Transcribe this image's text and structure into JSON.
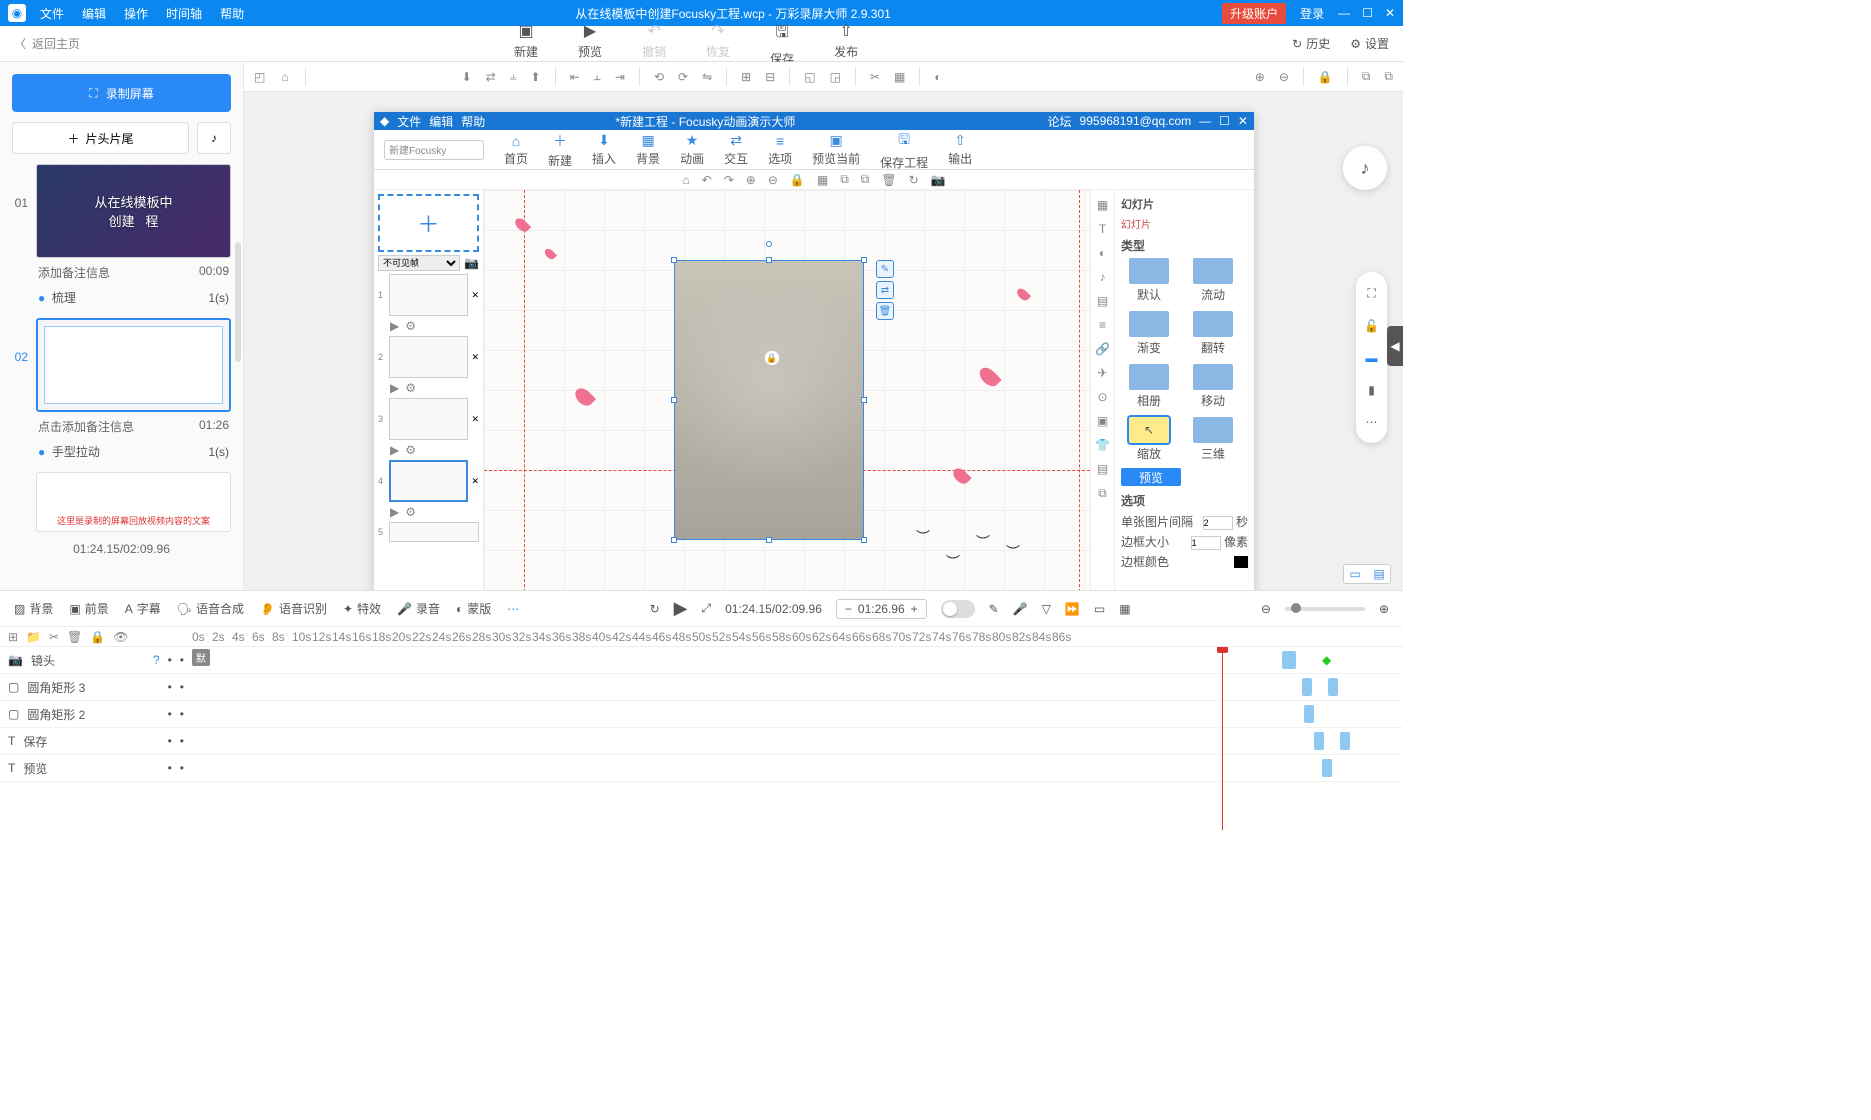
{
  "titlebar": {
    "menu": [
      "文件",
      "编辑",
      "操作",
      "时间轴",
      "帮助"
    ],
    "title": "从在线模板中创建Focusky工程.wcp - 万彩录屏大师 2.9.301",
    "upgrade": "升级账户",
    "login": "登录"
  },
  "subbar": {
    "back": "返回主页",
    "tools": [
      {
        "label": "新建",
        "icon": "＋"
      },
      {
        "label": "预览",
        "icon": "▶"
      },
      {
        "label": "撤销",
        "icon": "↶",
        "disabled": true
      },
      {
        "label": "恢复",
        "icon": "↷",
        "disabled": true
      },
      {
        "label": "保存",
        "icon": "🖫"
      },
      {
        "label": "发布",
        "icon": "⇧"
      }
    ],
    "history": "历史",
    "settings": "设置"
  },
  "leftpane": {
    "record": "录制屏幕",
    "headtail": "片头片尾",
    "slides": [
      {
        "num": "01",
        "note": "添加备注信息",
        "time": "00:09",
        "action": "梳理",
        "dur": "1(s)"
      },
      {
        "num": "02",
        "note": "点击添加备注信息",
        "time": "01:26",
        "action": "手型拉动",
        "dur": "1(s)",
        "selected": true
      }
    ],
    "timeTotal": "01:24.15/02:09.96"
  },
  "inner": {
    "title": "*新建工程 - Focusky动画演示大师",
    "menu": [
      "文件",
      "编辑",
      "帮助"
    ],
    "forum": "论坛",
    "user": "995968191@qq.com",
    "search": "新建Focusky",
    "tools": [
      "首页",
      "新建",
      "插入",
      "背景",
      "动画",
      "交互",
      "选项",
      "预览当前",
      "保存工程",
      "输出"
    ],
    "visibility": "不可见帧",
    "rightPanel": {
      "title": "幻灯片",
      "sub": "幻灯片",
      "section": "类型",
      "options": [
        "默认",
        "流动",
        "渐变",
        "翻转",
        "相册",
        "移动",
        "缩放",
        "三维"
      ],
      "preview": "预览",
      "opts_label": "选项",
      "fields": [
        {
          "label": "单张图片间隔",
          "value": "2",
          "unit": "秒"
        },
        {
          "label": "边框大小",
          "value": "1",
          "unit": "像素"
        },
        {
          "label": "边框颜色",
          "value": "#000"
        }
      ]
    }
  },
  "timeline": {
    "tabs": [
      "背景",
      "前景",
      "字幕",
      "语音合成",
      "语音识别",
      "特效",
      "录音",
      "蒙版"
    ],
    "time": "01:24.15/02:09.96",
    "box_time": "01:26.96",
    "tracks": [
      {
        "icon": "📷",
        "name": "镜头",
        "help": true,
        "default": "默"
      },
      {
        "icon": "▢",
        "name": "圆角矩形 3"
      },
      {
        "icon": "▢",
        "name": "圆角矩形 2"
      },
      {
        "icon": "T",
        "name": "保存"
      },
      {
        "icon": "T",
        "name": "预览"
      }
    ],
    "ticks": [
      "0s",
      "2s",
      "4s",
      "6s",
      "8s",
      "10s",
      "12s",
      "14s",
      "16s",
      "18s",
      "20s",
      "22s",
      "24s",
      "26s",
      "28s",
      "30s",
      "32s",
      "34s",
      "36s",
      "38s",
      "40s",
      "42s",
      "44s",
      "46s",
      "48s",
      "50s",
      "52s",
      "54s",
      "56s",
      "58s",
      "60s",
      "62s",
      "64s",
      "66s",
      "68s",
      "70s",
      "72s",
      "74s",
      "76s",
      "78s",
      "80s",
      "82s",
      "84s",
      "86s"
    ]
  }
}
